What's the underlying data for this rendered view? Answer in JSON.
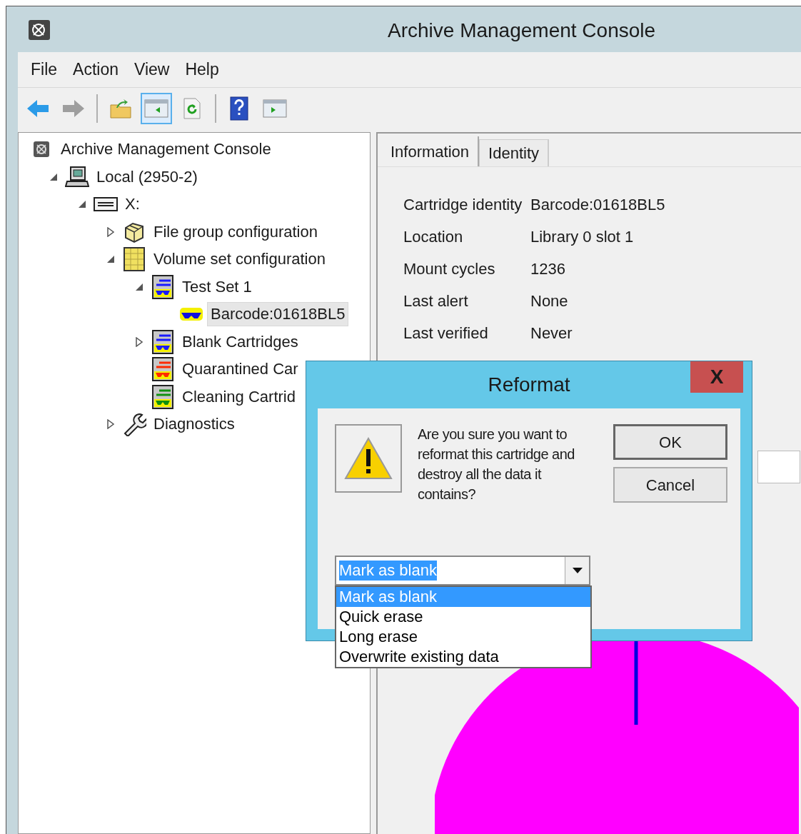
{
  "window": {
    "title": "Archive Management Console"
  },
  "menu": [
    "File",
    "Action",
    "View",
    "Help"
  ],
  "toolbar": [
    {
      "kind": "back",
      "pressed": false,
      "disabled": false
    },
    {
      "kind": "forward",
      "pressed": false,
      "disabled": true
    },
    {
      "kind": "separator"
    },
    {
      "kind": "up",
      "pressed": false,
      "disabled": false
    },
    {
      "kind": "tree",
      "pressed": true,
      "disabled": false
    },
    {
      "kind": "refresh",
      "pressed": false,
      "disabled": false
    },
    {
      "kind": "separator"
    },
    {
      "kind": "help",
      "pressed": false,
      "disabled": false
    },
    {
      "kind": "actionpane",
      "pressed": false,
      "disabled": false
    }
  ],
  "tree": [
    {
      "label": "Archive Management Console",
      "kind": "console",
      "selected": false,
      "children": [
        {
          "label": "Local (2950-2)",
          "kind": "computer",
          "expanded": true,
          "selected": false,
          "children": [
            {
              "label": "X:",
              "kind": "drive",
              "expanded": true,
              "selected": false,
              "children": [
                {
                  "label": "File group configuration",
                  "kind": "filegroup",
                  "expanded": false,
                  "selected": false
                },
                {
                  "label": "Volume set configuration",
                  "kind": "volumeset",
                  "expanded": true,
                  "selected": false,
                  "children": [
                    {
                      "label": "Test Set 1",
                      "kind": "set",
                      "color": "#1a1aff",
                      "expanded": true,
                      "selected": false,
                      "children": [
                        {
                          "label": "Barcode:01618BL5",
                          "kind": "cartridge",
                          "selected": true
                        }
                      ]
                    },
                    {
                      "label": "Blank Cartridges",
                      "kind": "set",
                      "color": "#1a1aff",
                      "expanded": false,
                      "selected": false
                    },
                    {
                      "label": "Quarantined Car",
                      "kind": "set",
                      "color": "#ff2a00",
                      "selected": false
                    },
                    {
                      "label": "Cleaning Cartrid",
                      "kind": "set",
                      "color": "#109010",
                      "selected": false
                    }
                  ]
                },
                {
                  "label": "Diagnostics",
                  "kind": "tool",
                  "expanded": false,
                  "selected": false
                }
              ]
            }
          ]
        }
      ]
    }
  ],
  "tabs": [
    {
      "label": "Information",
      "selected": true
    },
    {
      "label": "Identity",
      "selected": false
    }
  ],
  "properties": [
    {
      "label": "Cartridge identity",
      "value": "Barcode:01618BL5"
    },
    {
      "label": "Location",
      "value": "Library 0 slot 1"
    },
    {
      "label": "Mount cycles",
      "value": "1236"
    },
    {
      "label": "Last alert",
      "value": "None"
    },
    {
      "label": "Last verified",
      "value": "Never"
    }
  ],
  "dialog": {
    "title": "Reformat",
    "close": "X",
    "message": "Are you sure you want to reformat this cartridge and destroy all the data it contains?",
    "buttons": [
      {
        "label": "OK",
        "default": true
      },
      {
        "label": "Cancel",
        "default": false
      }
    ],
    "combo": {
      "value": "Mark as blank",
      "expanded": true,
      "options": [
        {
          "label": "Mark as blank",
          "selected": true
        },
        {
          "label": "Quick erase",
          "selected": false
        },
        {
          "label": "Long erase",
          "selected": false
        },
        {
          "label": "Overwrite existing data",
          "selected": false
        }
      ]
    }
  }
}
